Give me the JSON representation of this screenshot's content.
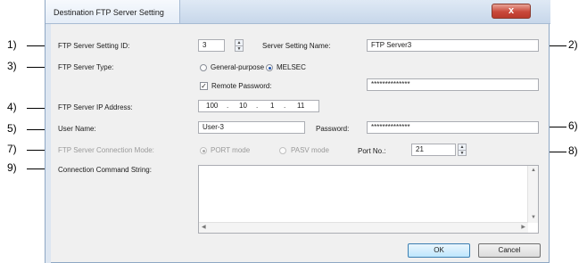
{
  "dialog": {
    "title": "Destination FTP Server Setting",
    "close_label": "x"
  },
  "callouts": [
    "1)",
    "2)",
    "3)",
    "4)",
    "5)",
    "6)",
    "7)",
    "8)",
    "9)"
  ],
  "fields": {
    "setting_id": {
      "label": "FTP Server Setting ID:",
      "value": "3"
    },
    "setting_name": {
      "label": "Server Setting Name:",
      "value": "FTP Server3"
    },
    "server_type": {
      "label": "FTP Server Type:",
      "options": [
        "General-purpose",
        "MELSEC"
      ],
      "selected": "MELSEC"
    },
    "remote_password": {
      "label": "Remote Password:",
      "checked": true,
      "value": "**************"
    },
    "ip_address": {
      "label": "FTP Server IP Address:",
      "octets": [
        "100",
        "10",
        "1",
        "11"
      ],
      "separator": "."
    },
    "user_name": {
      "label": "User Name:",
      "value": "User-3"
    },
    "password": {
      "label": "Password:",
      "value": "**************"
    },
    "connection_mode": {
      "label": "FTP Server Connection Mode:",
      "options": [
        "PORT mode",
        "PASV mode"
      ],
      "selected": "PORT mode",
      "disabled": true
    },
    "port_no": {
      "label": "Port No.:",
      "value": "21"
    },
    "command_string": {
      "label": "Connection Command String:",
      "value": ""
    }
  },
  "buttons": {
    "ok": "OK",
    "cancel": "Cancel"
  },
  "icons": {
    "spin_up": "spin-up-arrow-icon",
    "spin_down": "spin-down-arrow-icon",
    "close": "close-icon"
  }
}
